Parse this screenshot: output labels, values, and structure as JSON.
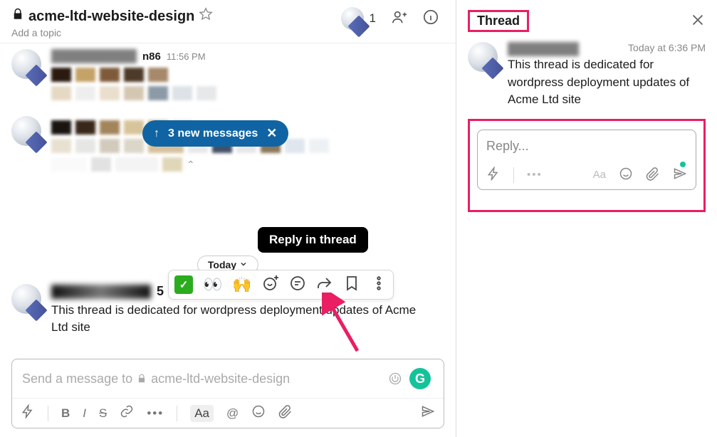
{
  "header": {
    "channel_name": "acme-ltd-website-design",
    "add_topic": "Add a topic",
    "member_count": "1"
  },
  "messages": {
    "first_timestamp": "11:56 PM",
    "first_name_suffix": "n86",
    "pill_label": "3 new messages",
    "date_divider": "Today",
    "tooltip": "Reply in thread",
    "second_time_suffix": "5",
    "second_text": "This thread is dedicated for wordpress deployment updates of Acme Ltd site"
  },
  "actions": {
    "check": "✓",
    "eyes": "👀",
    "hands": "🙌"
  },
  "composer": {
    "placeholder_prefix": "Send a message to",
    "placeholder_channel": "acme-ltd-website-design",
    "grammarly": "G",
    "bold": "B",
    "italic": "I",
    "strike": "S",
    "aa": "Aa",
    "at": "@"
  },
  "thread": {
    "title": "Thread",
    "timestamp": "Today at 6:36 PM",
    "message": "This thread is dedicated for wordpress deployment updates of Acme Ltd site",
    "reply_placeholder": "Reply...",
    "aa": "Aa"
  }
}
